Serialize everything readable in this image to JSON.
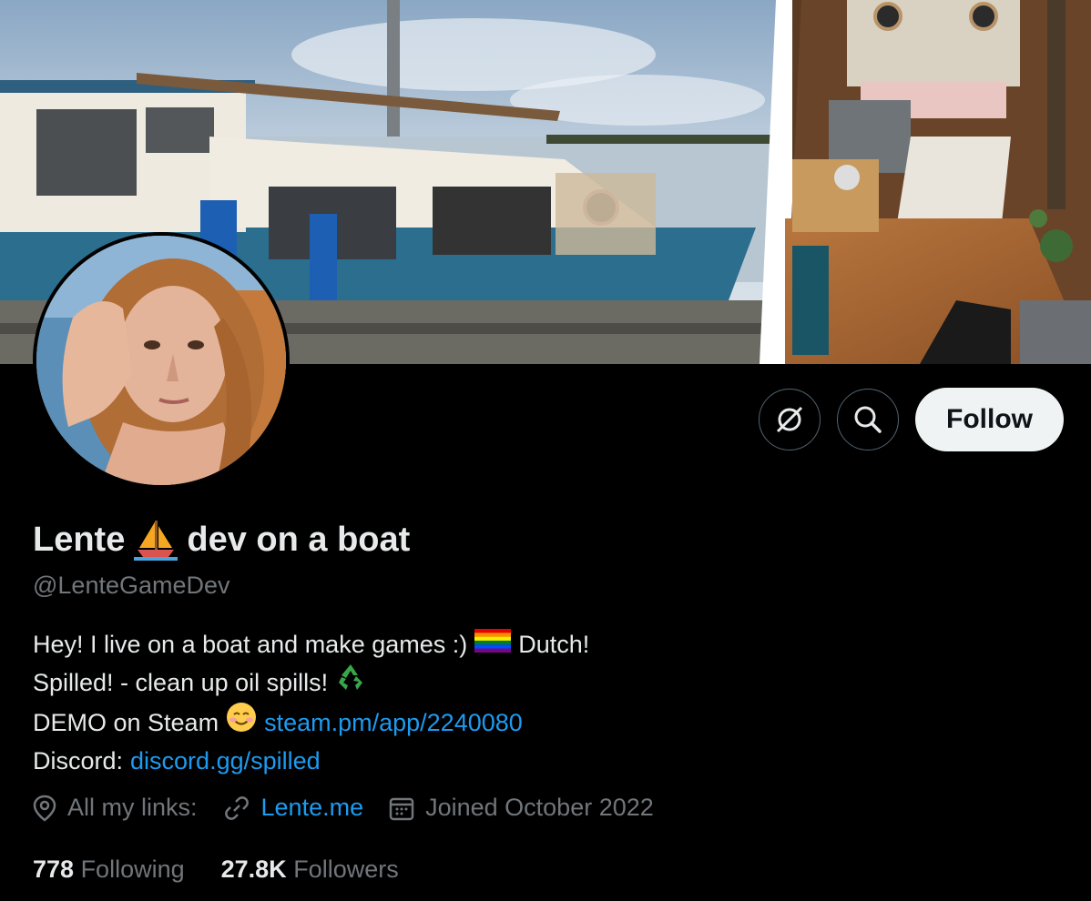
{
  "profile": {
    "name": "Lente",
    "name_suffix": "dev on a boat",
    "handle": "@LenteGameDev",
    "bio": {
      "line1_text": "Hey! I live on a boat and make games :)",
      "line1_suffix": "Dutch!",
      "line2_text": "Spilled! - clean up oil spills!",
      "line3_text": "DEMO on Steam",
      "line3_link": "steam.pm/app/2240080",
      "line4_text": "Discord:",
      "line4_link": "discord.gg/spilled"
    },
    "meta": {
      "location": "All my links:",
      "website": "Lente.me",
      "joined": "Joined October 2022"
    },
    "stats": {
      "following_count": "778",
      "following_label": "Following",
      "followers_count": "27.8K",
      "followers_label": "Followers"
    }
  },
  "actions": {
    "follow_label": "Follow"
  },
  "icons": {
    "more": "explore-slash-icon",
    "search": "search-icon",
    "location": "location-pin-icon",
    "link": "link-icon",
    "calendar": "calendar-icon"
  },
  "colors": {
    "background": "#000000",
    "text": "#e7e9ea",
    "muted": "#71767b",
    "link": "#1d9bf0",
    "follow_bg": "#eff3f4"
  }
}
